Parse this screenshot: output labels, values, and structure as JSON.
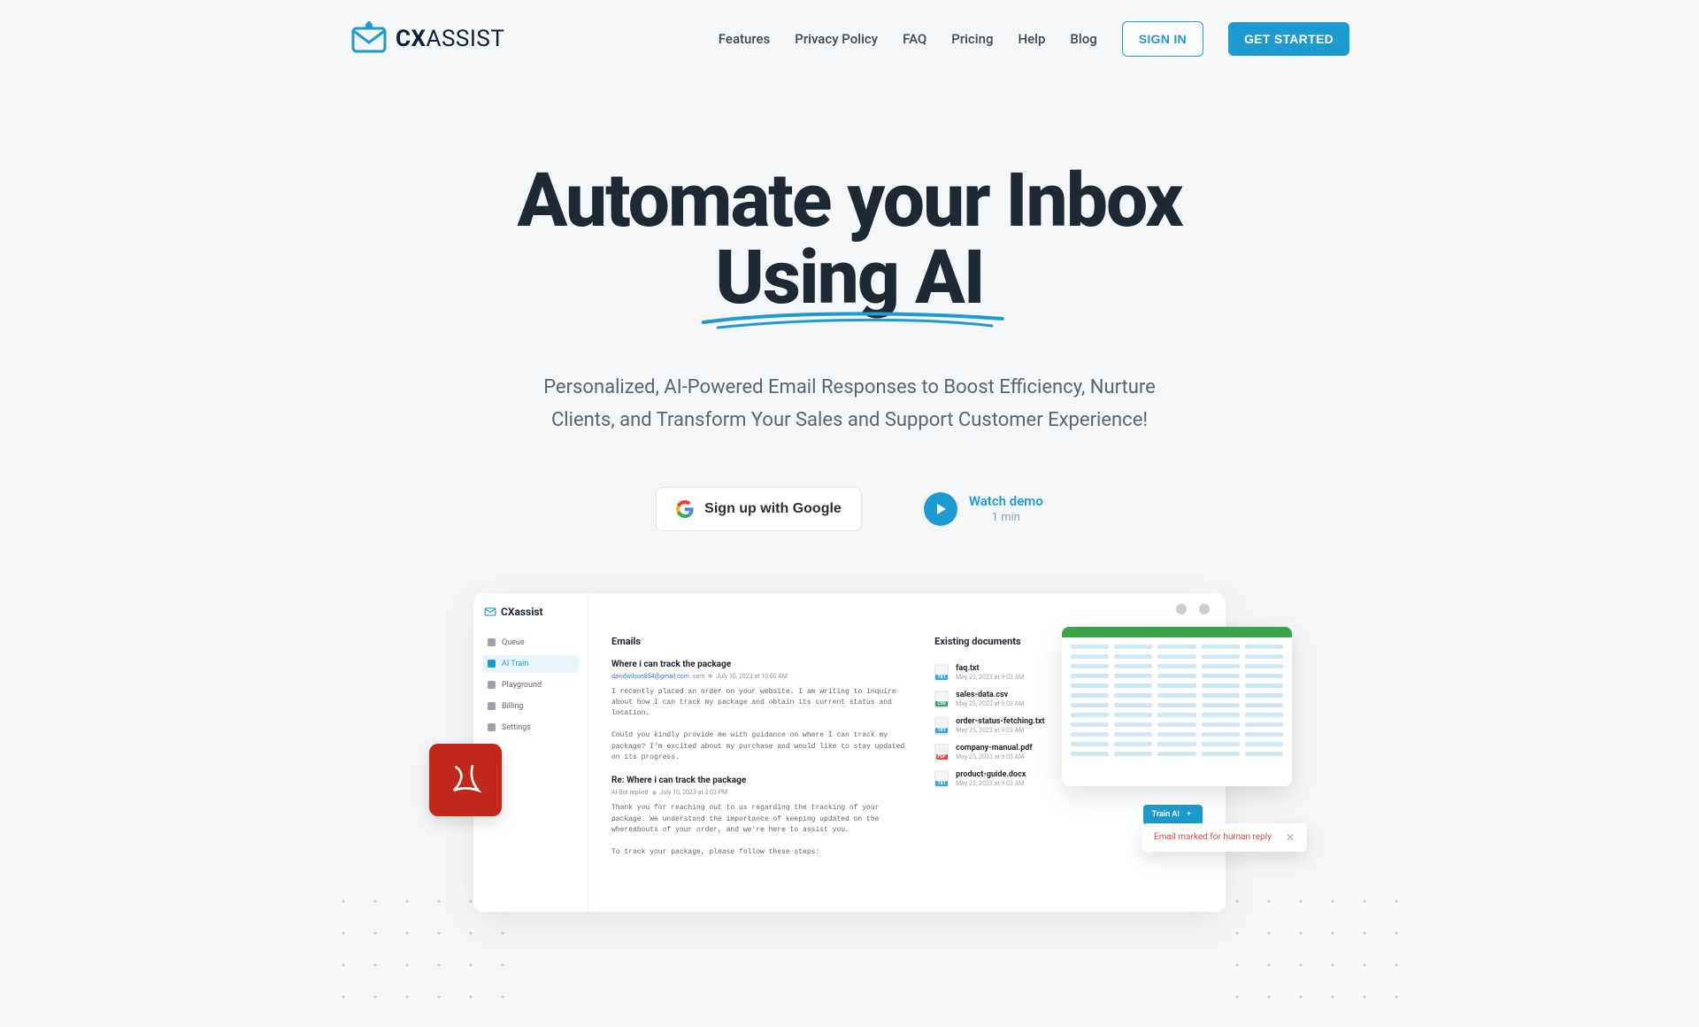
{
  "brand": {
    "cx": "CX",
    "assist": "ASSIST"
  },
  "nav": {
    "links": [
      "Features",
      "Privacy Policy",
      "FAQ",
      "Pricing",
      "Help",
      "Blog"
    ],
    "sign_in": "SIGN IN",
    "get_started": "GET STARTED"
  },
  "hero": {
    "line1": "Automate your Inbox",
    "line2": "Using AI",
    "subtitle": "Personalized, AI-Powered Email Responses to Boost Efficiency, Nurture Clients, and Transform Your Sales and Support Customer Experience!"
  },
  "cta": {
    "google": "Sign up with Google",
    "watch": "Watch demo",
    "watch_sub": "1 min"
  },
  "preview": {
    "app_brand": "CXassist",
    "side_items": [
      "Queue",
      "AI Train",
      "Playground",
      "Billing",
      "Settings"
    ],
    "side_active_index": 1,
    "emails_title": "Emails",
    "email1_subject": "Where i can track the package",
    "email1_from": "davidwilson854@gmail.com",
    "email1_sent_word": "sent",
    "email1_date": "July 10, 2023 at 10:00 AM",
    "email1_body": "I recently placed an order on your website. I am writing to inquire about how I can track my package and obtain its current status and location.\n\nCould you kindly provide me with guidance on where I can track my package? I'm excited about my purchase and would like to stay updated on its progress.",
    "email2_subject": "Re: Where i can track the package",
    "email2_from": "AI Bot replied",
    "email2_date": "July 10, 2023 at 3:03 PM",
    "email2_body": "Thank you for reaching out to us regarding the tracking of your package. We understand the importance of keeping updated on the whereabouts of your order, and we're here to assist you.\n\nTo track your package, please follow these steps:",
    "docs_title": "Existing documents",
    "docs": [
      {
        "name": "faq.txt",
        "date": "May 25, 2023 at 9:03 AM",
        "tag": "TXT",
        "color": "#3aa7dd",
        "actions": false
      },
      {
        "name": "sales-data.csv",
        "date": "May 25, 2023 at 9:03 AM",
        "tag": "CSV",
        "color": "#2fa862",
        "actions": false
      },
      {
        "name": "order-status-fetching.txt",
        "date": "May 25, 2023 at 9:03 AM",
        "tag": "TXT",
        "color": "#3aa7dd",
        "actions": true
      },
      {
        "name": "company-manual.pdf",
        "date": "May 25, 2023 at 9:03 AM",
        "tag": "PDF",
        "color": "#d84b4b",
        "actions": false
      },
      {
        "name": "product-guide.docx",
        "date": "May 25, 2023 at 9:03 AM",
        "tag": "TXT",
        "color": "#3aa7dd",
        "actions": true
      }
    ],
    "train_btn": "Train AI",
    "toast": "Email marked for human reply"
  },
  "colors": {
    "accent": "#1d9bd1",
    "pdf_red": "#c1281b",
    "sheet_green": "#3fa24a"
  }
}
